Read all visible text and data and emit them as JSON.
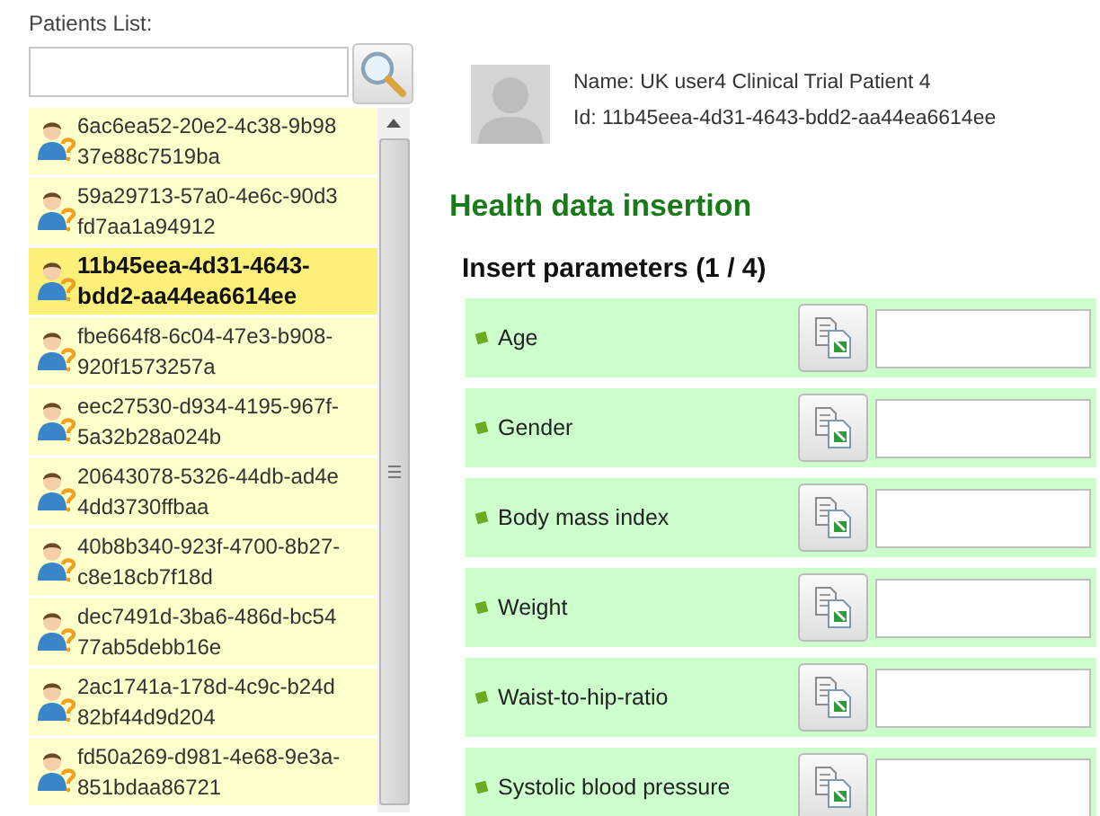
{
  "patients_list": {
    "label": "Patients List:",
    "items": [
      {
        "lines": [
          "6ac6ea52-20e2-4c38-9b98",
          "37e88c7519ba"
        ],
        "selected": false
      },
      {
        "lines": [
          "59a29713-57a0-4e6c-90d3",
          "fd7aa1a94912"
        ],
        "selected": false
      },
      {
        "lines": [
          "11b45eea-4d31-4643-",
          "bdd2-aa44ea6614ee"
        ],
        "selected": true
      },
      {
        "lines": [
          "fbe664f8-6c04-47e3-b908-",
          "920f1573257a"
        ],
        "selected": false
      },
      {
        "lines": [
          "eec27530-d934-4195-967f-",
          "5a32b28a024b"
        ],
        "selected": false
      },
      {
        "lines": [
          "20643078-5326-44db-ad4e",
          "4dd3730ffbaa"
        ],
        "selected": false
      },
      {
        "lines": [
          "40b8b340-923f-4700-8b27-",
          "c8e18cb7f18d"
        ],
        "selected": false
      },
      {
        "lines": [
          "dec7491d-3ba6-486d-bc54",
          "77ab5debb16e"
        ],
        "selected": false
      },
      {
        "lines": [
          "2ac1741a-178d-4c9c-b24d",
          "82bf44d9d204"
        ],
        "selected": false
      },
      {
        "lines": [
          "fd50a269-d981-4e68-9e3a-",
          "851bdaa86721"
        ],
        "selected": false
      }
    ]
  },
  "patient": {
    "name": "Name: UK user4 Clinical Trial Patient 4",
    "id": "Id: 11b45eea-4d31-4643-bdd2-aa44ea6614ee"
  },
  "heading": "Health data insertion",
  "subheading": "Insert parameters (1 / 4)",
  "parameters": [
    {
      "label": "Age"
    },
    {
      "label": "Gender"
    },
    {
      "label": "Body mass index"
    },
    {
      "label": "Weight"
    },
    {
      "label": "Waist-to-hip-ratio"
    },
    {
      "label": "Systolic blood pressure"
    }
  ]
}
